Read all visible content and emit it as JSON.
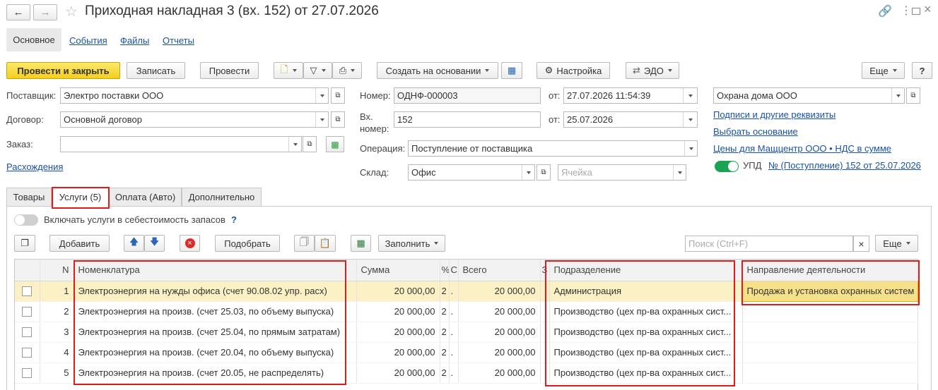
{
  "title": "Приходная накладная 3 (вх. 152) от 27.07.2026",
  "nav_tabs": [
    "Основное",
    "События",
    "Файлы",
    "Отчеты"
  ],
  "toolbar": {
    "post_close": "Провести и закрыть",
    "save": "Записать",
    "post": "Провести",
    "create_based": "Создать на основании",
    "settings": "Настройка",
    "edo": "ЭДО",
    "more": "Еще",
    "help": "?"
  },
  "form": {
    "supplier_label": "Поставщик:",
    "supplier": "Электро поставки ООО",
    "contract_label": "Договор:",
    "contract": "Основной договор",
    "order_label": "Заказ:",
    "order": "",
    "discrepancy_link": "Расхождения",
    "number_label": "Номер:",
    "number": "ОДНФ-000003",
    "from_label": "от:",
    "date": "27.07.2026 11:54:39",
    "in_number_label1": "Вх.",
    "in_number_label2": "номер:",
    "in_number": "152",
    "in_date": "25.07.2026",
    "operation_label": "Операция:",
    "operation": "Поступление от поставщика",
    "warehouse_label": "Склад:",
    "warehouse": "Офис",
    "cell_placeholder": "Ячейка",
    "org": "Охрана дома ООО",
    "link_signatures": "Подписи и другие реквизиты",
    "link_choose_basis": "Выбрать основание",
    "link_prices": "Цены для Мащцентр ООО • НДС в сумме",
    "upd_label": "УПД",
    "upd_link": "№ (Поступление) 152 от 25.07.2026"
  },
  "tabs": [
    "Товары",
    "Услуги (5)",
    "Оплата (Авто)",
    "Дополнительно"
  ],
  "services": {
    "include_toggle_label": "Включать услуги в себестоимость запасов",
    "include_help": "?",
    "add": "Добавить",
    "pick": "Подобрать",
    "fill": "Заполнить",
    "search_placeholder": "Поиск (Ctrl+F)",
    "search_clear": "×",
    "more": "Еще"
  },
  "table": {
    "headers": {
      "n": "N",
      "item": "Номенклатура",
      "sum": "Сумма",
      "c1": "%",
      "c2": "С",
      "total": "Всего",
      "c3": "З",
      "dept": "Подразделение",
      "direction": "Направление деятельности"
    },
    "rows": [
      {
        "n": "1",
        "item": "Электроэнергия на нужды офиса (счет 90.08.02 упр. расх)",
        "sum": "20 000,00",
        "c1": "2",
        "c2": ".",
        "total": "20 000,00",
        "dept": "Администрация",
        "direction": "Продажа и установка охранных систем"
      },
      {
        "n": "2",
        "item": "Электроэнергия на произв. (счет 25.03, по объему выпуска)",
        "sum": "20 000,00",
        "c1": "2",
        "c2": ".",
        "total": "20 000,00",
        "dept": "Производство (цех пр-ва охранных сист...",
        "direction": ""
      },
      {
        "n": "3",
        "item": "Электроэнергия на произв. (счет 25.04, по прямым затратам)",
        "sum": "20 000,00",
        "c1": "2",
        "c2": ".",
        "total": "20 000,00",
        "dept": "Производство (цех пр-ва охранных сист...",
        "direction": ""
      },
      {
        "n": "4",
        "item": "Электроэнергия на произв. (счет 20.04, по объему выпуска)",
        "sum": "20 000,00",
        "c1": "2",
        "c2": ".",
        "total": "20 000,00",
        "dept": "Производство (цех пр-ва охранных сист...",
        "direction": ""
      },
      {
        "n": "5",
        "item": "Электроэнергия на произв. (счет 20.05, не распределять)",
        "sum": "20 000,00",
        "c1": "2",
        "c2": ".",
        "total": "20 000,00",
        "dept": "Производство (цех пр-ва охранных сист...",
        "direction": ""
      }
    ]
  },
  "colors": {
    "accent": "#f4cf1f",
    "link": "#1a52a5",
    "highlight": "#e01b1b",
    "toggle_on": "#1ba354"
  }
}
